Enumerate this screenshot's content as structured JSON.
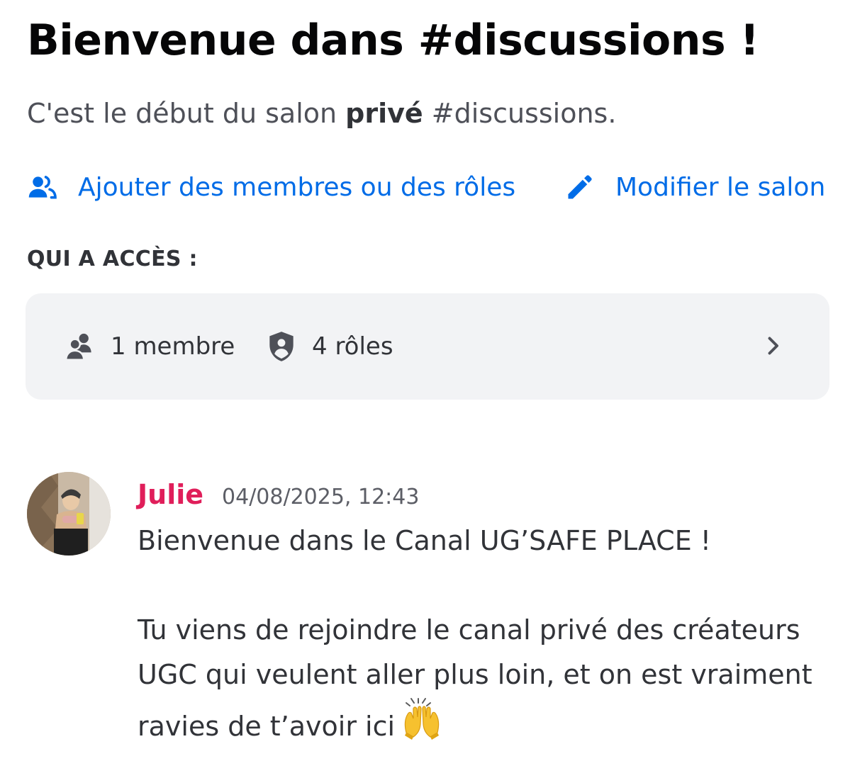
{
  "header": {
    "title": "Bienvenue dans #discussions !",
    "subtitle_prefix": "C'est le début du salon ",
    "subtitle_bold": "privé",
    "subtitle_suffix": " #discussions."
  },
  "actions": {
    "add_members": {
      "label": "Ajouter des membres ou des rôles",
      "icon": "add-members-icon"
    },
    "edit_channel": {
      "label": "Modifier le salon",
      "icon": "pencil-icon"
    }
  },
  "access": {
    "heading": "QUI A ACCÈS :",
    "members": {
      "label": "1 membre",
      "icon": "members-icon"
    },
    "roles": {
      "label": "4 rôles",
      "icon": "shield-icon"
    },
    "chevron_icon": "chevron-right-icon"
  },
  "message": {
    "author": "Julie",
    "timestamp": "04/08/2025, 12:43",
    "line1": "Bienvenue dans le Canal UG’SAFE PLACE !",
    "line2": "Tu viens de rejoindre le canal privé des créateurs UGC qui veulent aller plus loin, et on est vraiment ravies de t’avoir ici",
    "emoji": "raising-hands-emoji"
  },
  "colors": {
    "link": "#006ce7",
    "username": "#e01e5a",
    "card_bg": "#f2f3f5",
    "text_muted": "#4e5058"
  }
}
